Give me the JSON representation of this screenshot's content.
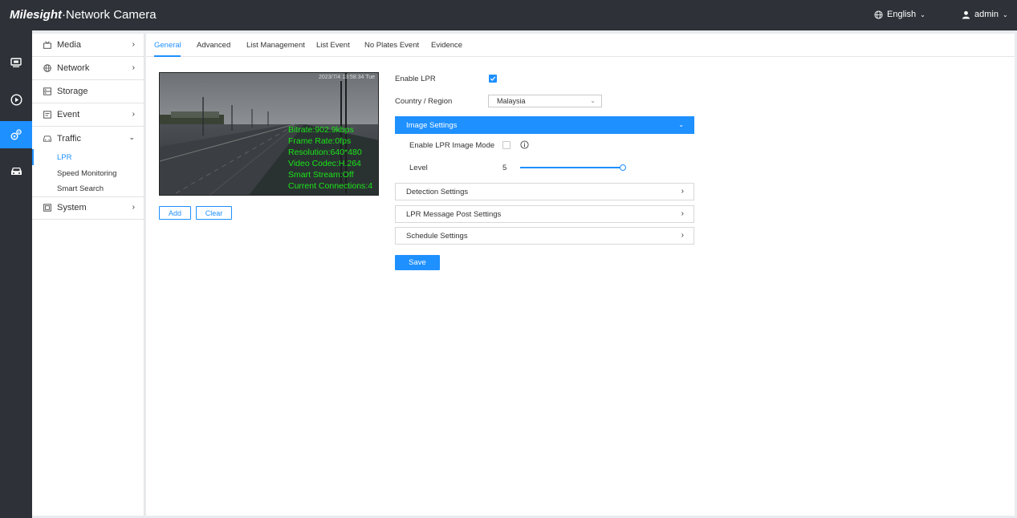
{
  "header": {
    "logo_brand": "Milesight",
    "logo_product": "·Network Camera",
    "language": "English",
    "user": "admin"
  },
  "iconbar": {
    "items": [
      {
        "icon": "live-view-icon"
      },
      {
        "icon": "playback-icon"
      },
      {
        "icon": "settings-icon",
        "active": true
      },
      {
        "icon": "vehicle-icon"
      }
    ]
  },
  "sidebar": {
    "items": [
      {
        "label": "Media",
        "icon": "media-icon"
      },
      {
        "label": "Network",
        "icon": "globe-icon"
      },
      {
        "label": "Storage",
        "icon": "storage-icon"
      },
      {
        "label": "Event",
        "icon": "event-icon"
      },
      {
        "label": "Traffic",
        "icon": "car-icon",
        "expanded": true
      },
      {
        "label": "System",
        "icon": "system-icon"
      }
    ],
    "traffic_sub": [
      "LPR",
      "Speed Monitoring",
      "Smart Search"
    ]
  },
  "tabs": [
    "General",
    "Advanced",
    "List Management",
    "List Event",
    "No Plates Event",
    "Evidence"
  ],
  "video": {
    "timestamp": "2023/7/4 13:58:34 Tue",
    "osd": [
      "Bitrate:902.9kbps",
      "Frame Rate:0fps",
      "Resolution:640*480",
      "Video Codec:H.264",
      "Smart Stream:Off",
      "Current Connections:4"
    ]
  },
  "roi_buttons": {
    "add": "Add",
    "clear": "Clear"
  },
  "form": {
    "enable_lpr_label": "Enable LPR",
    "enable_lpr": true,
    "country_label": "Country / Region",
    "country_value": "Malaysia",
    "image_settings": "Image Settings",
    "enable_image_mode_label": "Enable LPR Image Mode",
    "enable_image_mode": false,
    "level_label": "Level",
    "level_value": "5",
    "detection_settings": "Detection Settings",
    "message_post_settings": "LPR Message Post Settings",
    "schedule_settings": "Schedule Settings",
    "save": "Save"
  },
  "colors": {
    "accent": "#1e90ff",
    "topbar": "#2e3238",
    "osd_text": "#19e619"
  }
}
